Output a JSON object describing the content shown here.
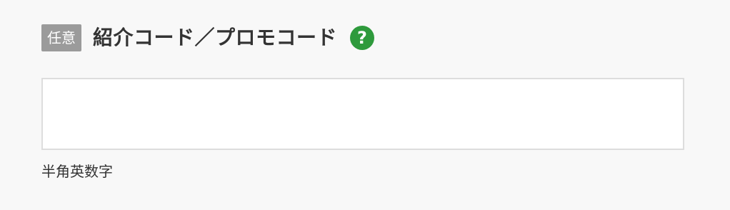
{
  "field": {
    "badge_label": "任意",
    "title": "紹介コード／プロモコード",
    "help_icon_glyph": "?",
    "help_icon_name": "help-question-icon",
    "input_value": "",
    "input_placeholder": "",
    "hint": "半角英数字"
  },
  "colors": {
    "badge_bg": "#9b9b9b",
    "help_icon_bg": "#2e9a3c",
    "input_border": "#dddddd",
    "page_bg": "#f8f8f8"
  }
}
